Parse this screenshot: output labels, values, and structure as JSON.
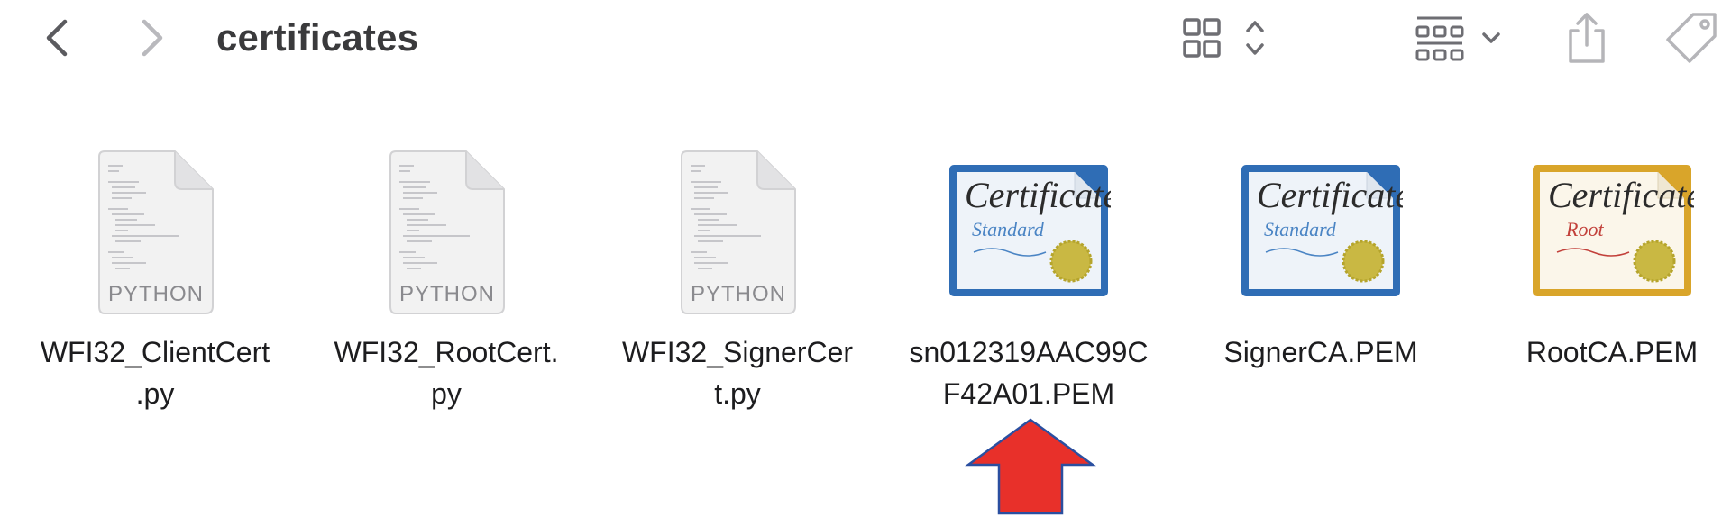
{
  "window": {
    "title": "certificates"
  },
  "toolbar": {
    "back_icon": "chevron-left-icon",
    "forward_icon": "chevron-right-icon",
    "view_icon": "icon-grid-view-icon",
    "group_icon": "group-by-icon",
    "share_icon": "share-icon",
    "tag_icon": "tag-icon"
  },
  "files": [
    {
      "line1": "WFI32_ClientCert",
      "line2": ".py",
      "kind": "python",
      "badge": "PYTHON"
    },
    {
      "line1": "WFI32_RootCert.",
      "line2": "py",
      "kind": "python",
      "badge": "PYTHON"
    },
    {
      "line1": "WFI32_SignerCer",
      "line2": "t.py",
      "kind": "python",
      "badge": "PYTHON"
    },
    {
      "line1": "sn012319AAC99C",
      "line2": "F42A01.PEM",
      "kind": "certificate",
      "cert_title": "Certificate",
      "cert_type": "Standard"
    },
    {
      "line1": "SignerCA.PEM",
      "line2": "",
      "kind": "certificate",
      "cert_title": "Certificate",
      "cert_type": "Standard"
    },
    {
      "line1": "RootCA.PEM",
      "line2": "",
      "kind": "certificate-root",
      "cert_title": "Certificate",
      "cert_type": "Root"
    }
  ],
  "annotation": {
    "arrow_color": "#e8302a",
    "arrow_outline": "#2a4fa0"
  },
  "colors": {
    "cert_standard_frame": "#2f6db5",
    "cert_root_frame": "#d9a52a",
    "seal": "#c9b843"
  }
}
